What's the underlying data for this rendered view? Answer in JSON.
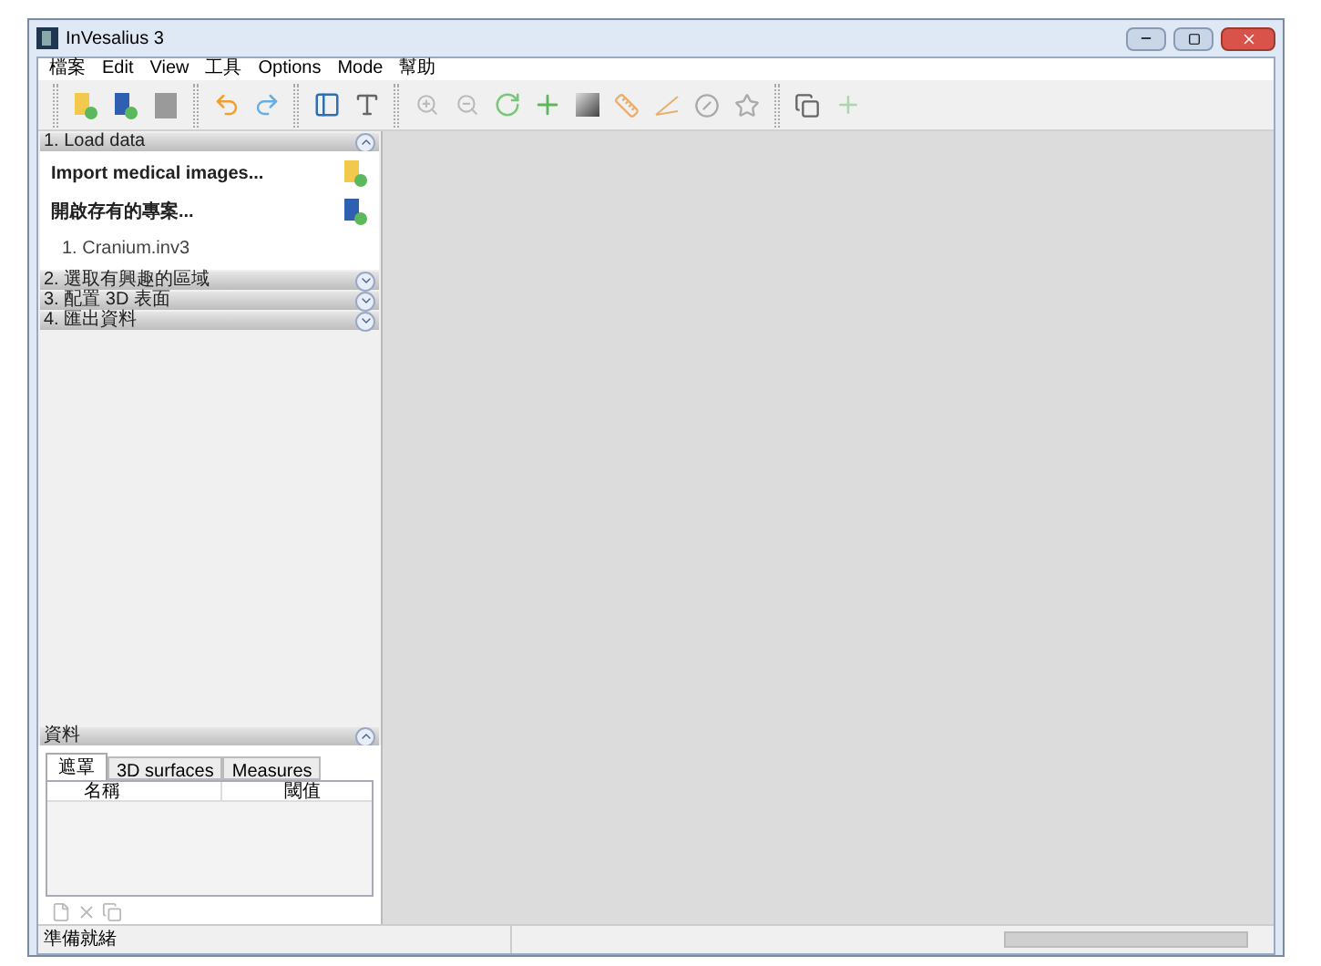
{
  "window": {
    "title": "InVesalius 3"
  },
  "menu": [
    "檔案",
    "Edit",
    "View",
    "工具",
    "Options",
    "Mode",
    "幫助"
  ],
  "steps": [
    {
      "title": "1. Load data",
      "expanded": true,
      "actions": [
        {
          "label": "Import medical images..."
        },
        {
          "label": "開啟存有的專案..."
        }
      ],
      "recent": [
        "1. Cranium.inv3"
      ]
    },
    {
      "title": "2. 選取有興趣的區域",
      "expanded": false
    },
    {
      "title": "3. 配置 3D 表面",
      "expanded": false
    },
    {
      "title": "4. 匯出資料",
      "expanded": false
    }
  ],
  "data_panel": {
    "title": "資料",
    "expanded": true,
    "tabs": [
      {
        "label": "遮罩",
        "selected": true
      },
      {
        "label": "3D surfaces",
        "selected": false
      },
      {
        "label": "Measures",
        "selected": false
      }
    ],
    "columns": [
      "名稱",
      "閾值"
    ]
  },
  "status_bar": {
    "text": "準備就緒",
    "progress": {
      "level": 0
    }
  }
}
